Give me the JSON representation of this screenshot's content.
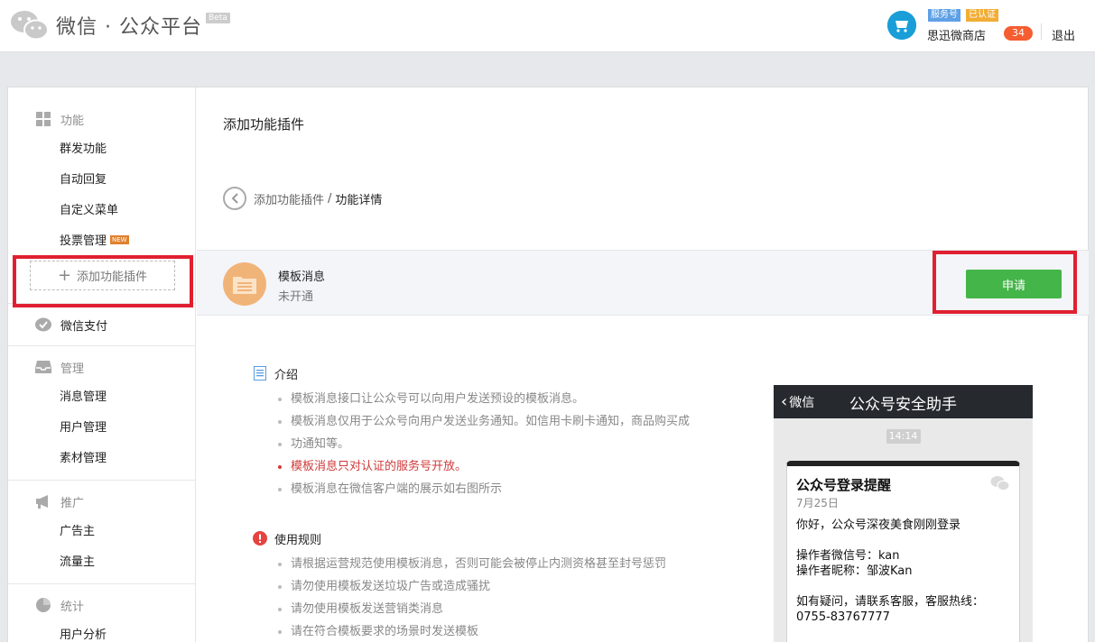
{
  "header": {
    "logo_title": "微信 · 公众平台",
    "beta": "Beta",
    "account": {
      "tag_service": "服务号",
      "tag_verified": "已认证",
      "name": "思迅微商店",
      "notification_count": "34",
      "logout": "退出"
    }
  },
  "sidebar": {
    "groups": [
      {
        "head": "功能",
        "icon": "grid-icon",
        "items": [
          "群发功能",
          "自动回复",
          "自定义菜单",
          "投票管理"
        ],
        "new_tag": "NEW",
        "add_plugin": "添加功能插件"
      },
      {
        "head": "微信支付",
        "icon": "wechat-pay-icon",
        "items": []
      },
      {
        "head": "管理",
        "icon": "inbox-icon",
        "items": [
          "消息管理",
          "用户管理",
          "素材管理"
        ]
      },
      {
        "head": "推广",
        "icon": "megaphone-icon",
        "items": [
          "广告主",
          "流量主"
        ]
      },
      {
        "head": "统计",
        "icon": "pie-chart-icon",
        "items": [
          "用户分析"
        ]
      }
    ]
  },
  "main": {
    "page_title": "添加功能插件",
    "breadcrumb": {
      "parent": "添加功能插件",
      "sep": "/",
      "current": "功能详情"
    },
    "plugin": {
      "name": "模板消息",
      "status": "未开通",
      "apply_label": "申请"
    },
    "intro": {
      "title": "介绍",
      "items": [
        "模板消息接口让公众号可以向用户发送预设的模板消息。",
        "模板消息仅用于公众号向用户发送业务通知。如信用卡刷卡通知，商品购买成",
        "功通知等。",
        "模板消息只对认证的服务号开放。",
        "模板消息在微信客户端的展示如右图所示"
      ]
    },
    "rules": {
      "title": "使用规则",
      "items": [
        "请根据运营规范使用模板消息，否则可能会被停止内测资格甚至封号惩罚",
        "请勿使用模板发送垃圾广告或造成骚扰",
        "请勿使用模板发送营销类消息",
        "请在符合模板要求的场景时发送模板"
      ]
    },
    "phone": {
      "back": "微信",
      "title": "公众号安全助手",
      "time": "14:14",
      "msg_title": "公众号登录提醒",
      "msg_date": "7月25日",
      "line1": "你好，公众号深夜美食刚刚登录",
      "line2": "操作者微信号：kan",
      "line3": "操作者昵称：邹波Kan",
      "line4": "如有疑问，请联系客服，客服热线：",
      "line5": "0755-83767777"
    }
  },
  "colors": {
    "accent_green": "#44b549",
    "highlight_red": "#e02030",
    "warn_red": "#d03a3a",
    "badge_orange": "#f65d30"
  }
}
